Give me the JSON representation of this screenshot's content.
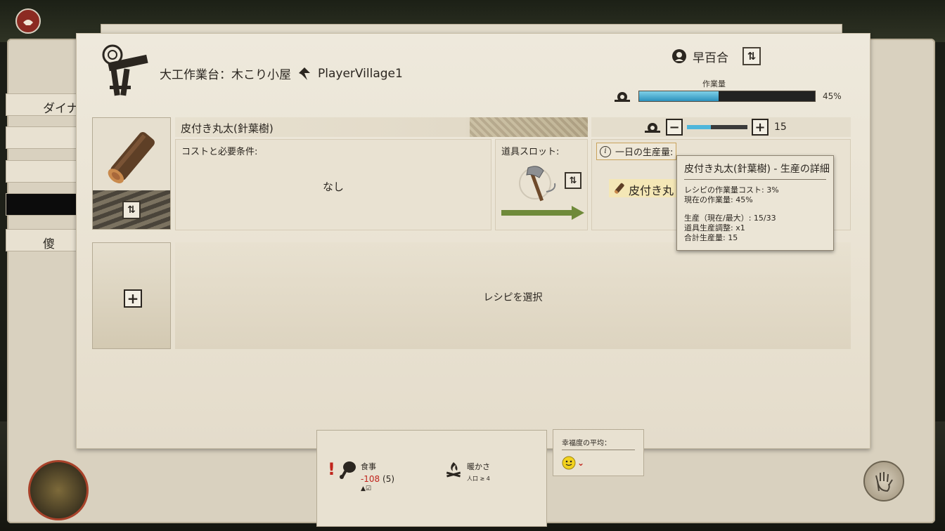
{
  "header": {
    "station_title": "大工作業台：木こり小屋",
    "village_name": "PlayerVillage1"
  },
  "worker": {
    "name": "早百合"
  },
  "workload": {
    "label": "作業量",
    "percent_text": "45%",
    "fill_fraction": 0.45,
    "bar_color": "#2c92bd"
  },
  "side_tabs": [
    {
      "label": "ダイナ"
    },
    {
      "label": ""
    },
    {
      "label": ""
    },
    {
      "label": ""
    },
    {
      "label": "傻"
    }
  ],
  "recipe": {
    "name": "皮付き丸太(針葉樹)",
    "cost_label": "コストと必要条件:",
    "cost_value": "なし",
    "tool_slot_label": "道具スロット:",
    "daily_output_label": "一日の生産量:",
    "output_item": "皮付き丸",
    "workers_count": "15",
    "workers_fill_fraction": 0.4
  },
  "empty_slot": {
    "select_label": "レシピを選択"
  },
  "tooltip": {
    "title": "皮付き丸太(針葉樹) - 生産の詳細",
    "lines_a": [
      "レシピの作業量コスト: 3%",
      "現在の作業量: 45%"
    ],
    "lines_b": [
      "生産（現在/最大）: 15/33",
      "道具生産調整: x1",
      "合計生産量: 15"
    ]
  },
  "status": {
    "food_label": "食事",
    "food_value": "-108",
    "food_count": "(5)",
    "warmth_label": "暖かさ",
    "warmth_sub": "人口 ≥ 4",
    "happiness_label": "幸福度の平均："
  },
  "icons": {
    "station": "carpentry-bench-icon",
    "village": "village-marker-icon",
    "worker": "worker-portrait-icon",
    "swap": "swap-icon",
    "gear": "workload-gear-icon",
    "tool": "axe-icon",
    "food": "meat-icon",
    "warmth": "campfire-icon",
    "happiness": "smiley-icon"
  },
  "colors": {
    "accent_negative": "#c0241c",
    "parchment": "#e9e2d2",
    "output_chip": "#f4e7b6"
  }
}
